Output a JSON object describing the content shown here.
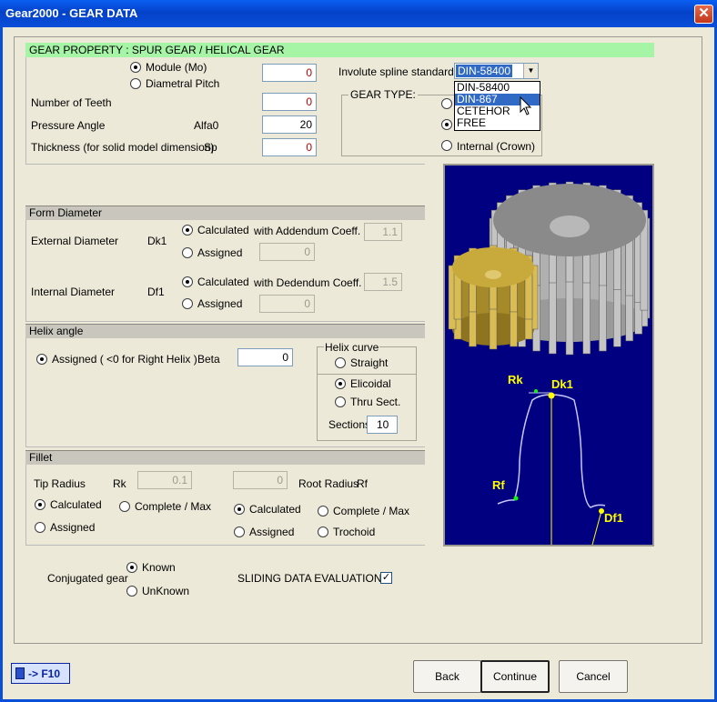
{
  "window": {
    "title": "Gear2000 - GEAR DATA",
    "close_symbol": "✕"
  },
  "gear_property": {
    "header": "GEAR PROPERTY : SPUR GEAR / HELICAL GEAR",
    "module_label": "Module (Mo)",
    "diametral_pitch_label": "Diametral Pitch",
    "module_value": "0",
    "teeth_label": "Number of Teeth",
    "teeth_value": "0",
    "pressure_label": "Pressure Angle",
    "pressure_symbol": "Alfa0",
    "pressure_value": "20",
    "thickness_label": "Thickness (for solid model dimension)",
    "thickness_symbol": "Sp",
    "thickness_value": "0"
  },
  "spline": {
    "label": "Involute spline standard",
    "selected": "DIN-58400",
    "options": [
      "DIN-58400",
      "DIN-867",
      "CETEHOR",
      "FREE"
    ],
    "highlighted_index": 1
  },
  "gear_type": {
    "title": "GEAR TYPE:",
    "internal_label": "Internal (Crown)"
  },
  "form_diameter": {
    "header": "Form Diameter",
    "external_label": "External Diameter",
    "external_symbol": "Dk1",
    "internal_label": "Internal Diameter",
    "internal_symbol": "Df1",
    "calculated": "Calculated",
    "assigned": "Assigned",
    "addendum_label": "with Addendum Coeff.",
    "addendum_value": "1.1",
    "dedendum_label": "with Dedendum Coeff.",
    "dedendum_value": "1.5",
    "ext_assigned_value": "0",
    "int_assigned_value": "0"
  },
  "helix": {
    "header": "Helix angle",
    "assigned_label": "Assigned ( <0 for Right Helix )",
    "beta_label": "Beta",
    "beta_value": "0",
    "curve_title": "Helix curve",
    "straight": "Straight",
    "elicoidal": "Elicoidal",
    "thru": "Thru Sect.",
    "sections_label": "Sections",
    "sections_value": "10"
  },
  "fillet": {
    "header": "Fillet",
    "tip_label": "Tip Radius",
    "tip_symbol": "Rk",
    "tip_value": "0.1",
    "root_value": "0",
    "root_label": "Root Radius",
    "root_symbol": "Rf",
    "calculated": "Calculated",
    "assigned": "Assigned",
    "complete": "Complete /  Max",
    "trochoid": "Trochoid"
  },
  "conjugated": {
    "label": "Conjugated gear",
    "known": "Known",
    "unknown": "UnKnown"
  },
  "sliding": {
    "label": "SLIDING DATA EVALUATION",
    "checked": "✓"
  },
  "preview": {
    "label_rk": "Rk",
    "label_dk1": "Dk1",
    "label_rf": "Rf",
    "label_df1": "Df1",
    "bg_color": "#000080",
    "gear_large_color": "#8a8a8a",
    "gear_small_color": "#c8a93c",
    "profile_color": "#ffff00"
  },
  "footer": {
    "calc_label": "-> F10",
    "back": "Back",
    "continue": "Continue",
    "cancel": "Cancel"
  }
}
